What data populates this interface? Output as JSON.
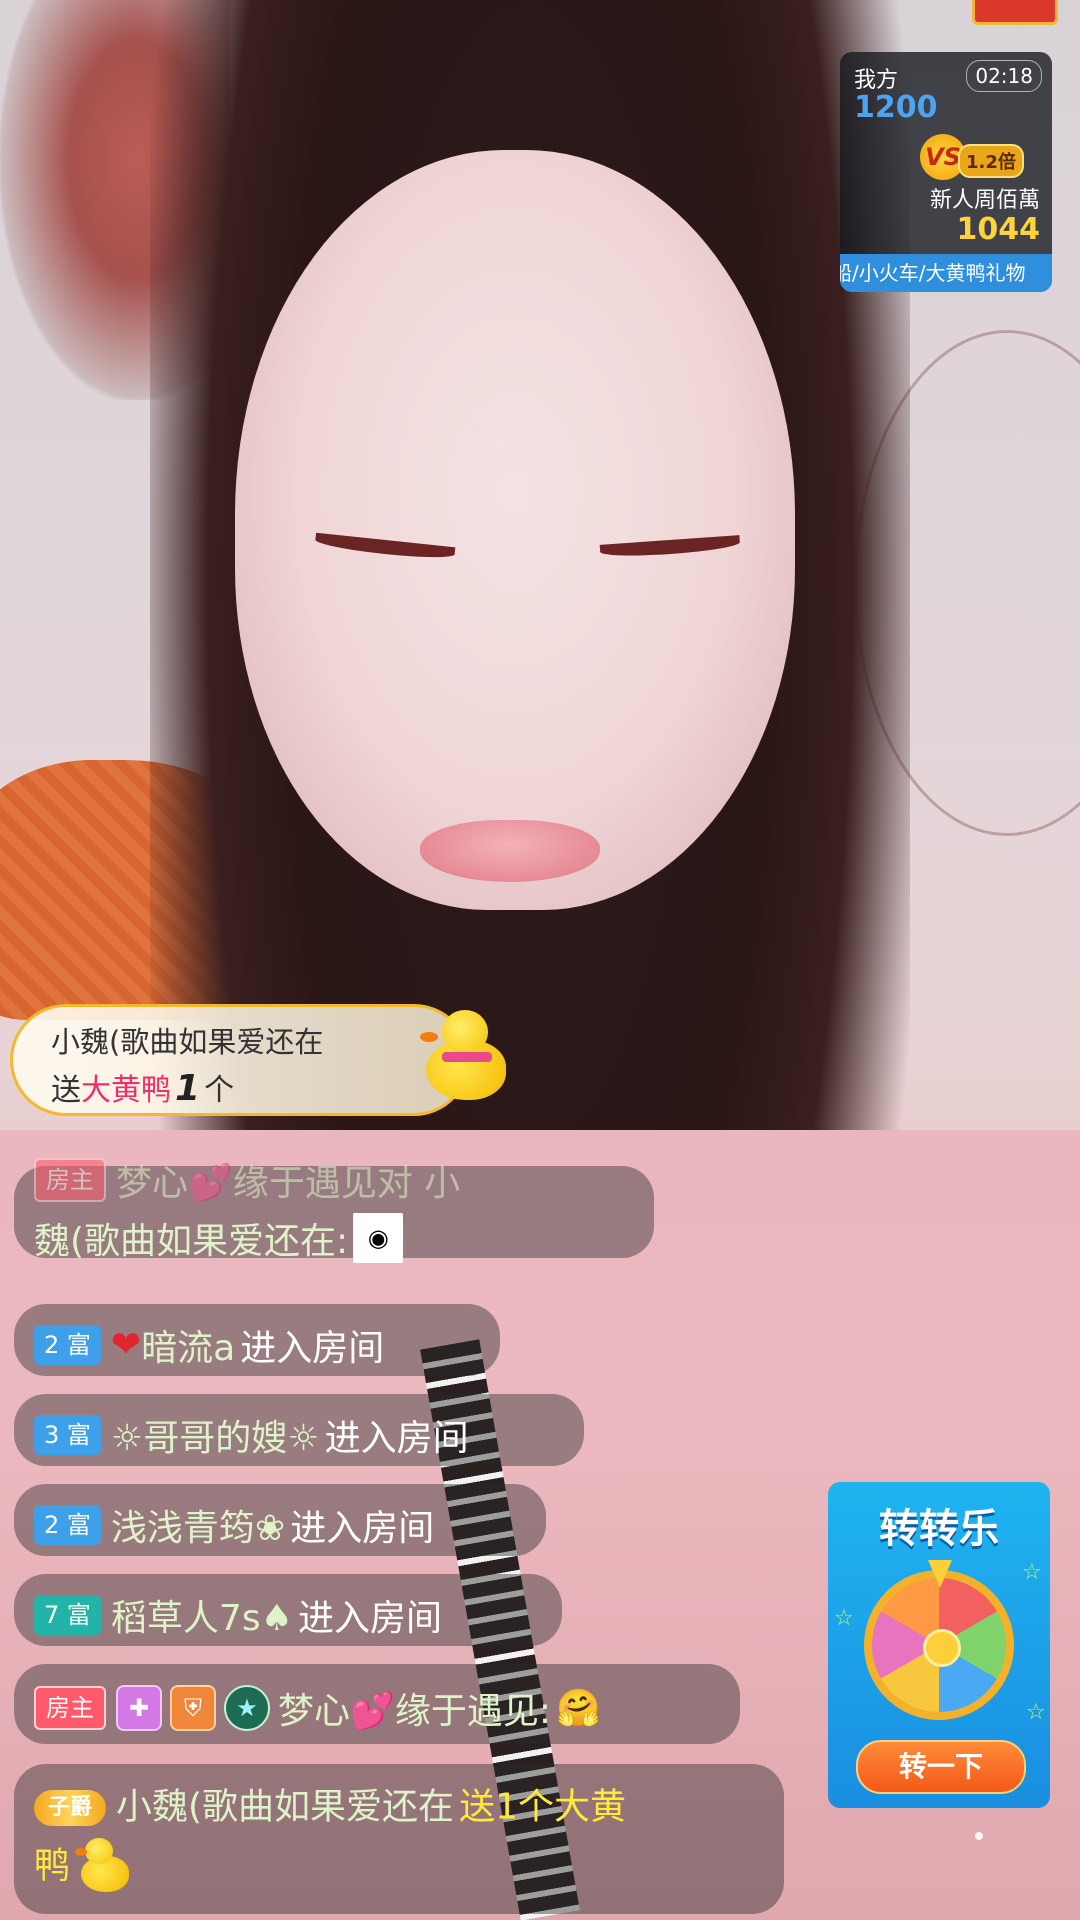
{
  "pk_panel": {
    "team1_label": "我方",
    "team1_score": "1200",
    "timer": "02:18",
    "vs_label": "VS",
    "multiplier": "1.2倍",
    "team2_label": "新人周佰萬",
    "team2_score": "1044",
    "marquee": "船/小火车/大黄鸭礼物"
  },
  "gift_banner": {
    "sender": "小魏(歌曲如果爱还在",
    "send_prefix": "送",
    "gift_name": "大黄鸭",
    "count": "1",
    "unit": "个"
  },
  "chat": {
    "partial_top": {
      "badge": "房主",
      "text": "梦心💕缘于遇见对 小",
      "continuation": "魏(歌曲如果爱还在:"
    },
    "entries": [
      {
        "badge_num": "2",
        "badge_label": "富",
        "name": "暗流a",
        "action": "进入房间",
        "prefix_icon": "heart-icon"
      },
      {
        "badge_num": "3",
        "badge_label": "富",
        "name": "☼哥哥的嫂☼",
        "action": "进入房间"
      },
      {
        "badge_num": "2",
        "badge_label": "富",
        "name": "浅浅青筠❀",
        "action": "进入房间"
      },
      {
        "badge_num": "7",
        "badge_label": "富",
        "name": "稻草人7s♠",
        "action": "进入房间"
      }
    ],
    "host_msg": {
      "badge": "房主",
      "name": "梦心💕缘于遇见:",
      "emoji": "🤗"
    },
    "gift_msg": {
      "noble_badge": "子爵",
      "name": "小魏(歌曲如果爱还在",
      "gift_text_1": "送1个大黄",
      "gift_text_2": "鸭"
    }
  },
  "wheel": {
    "title": "转转乐",
    "button": "转一下"
  },
  "colors": {
    "accent_gold": "#f3b82e",
    "pk_blue": "#4ba3f2",
    "pk_yellow": "#ffd43a",
    "gift_pink": "#ef2d6a",
    "wheel_blue": "#1fb4f0"
  }
}
